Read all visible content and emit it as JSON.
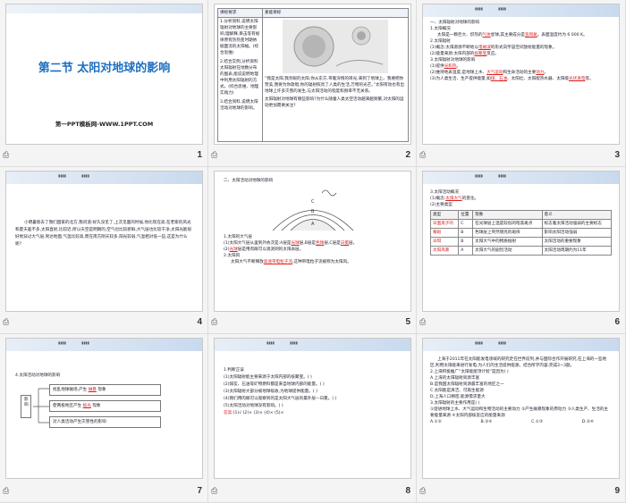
{
  "footer_icon": "⎙",
  "slides": [
    {
      "num": "1",
      "title": "第二节  太阳对地球的影响",
      "subtitle": "第一PPT模板网-WWW.1PPT.COM"
    },
    {
      "num": "2",
      "head_left": "课标要求",
      "head_right": "素能目标",
      "left_lines": [
        "1.分析资料,说明太阳辐射对地球的主要影响,理解释,目击等有规律原有热热变时期依据面流的太阳幅。(综合思维)",
        "2.结合实例,分析资料太阳辐射在地数分布的图表,能说说明地理中利用太阳辐射的方式。(综合思维、地理实践力)",
        "3.结合资料,说明太阳活动对地球的影响。"
      ],
      "right_text": "“我是太阳,我亲眼的太阳,你从东方,带着深情的目光,来到了地球上。我要把你赞美,我要为你歌唱,你的辐射照亮了人类的生活,万物的光芒。”太阳有动也有出地球上许多灾害的发生,与太阳活动的程度和频率不无关系。",
      "right_q": "太阳辐射对地球有哪些影响?为什么随着人类太空活动越来越频繁,对太阳的运动更加需要关注?"
    },
    {
      "num": "3",
      "heading": "一、太阳辐射对地球的影响",
      "s1": "1.太阳概况",
      "p1a": "太阳是一颗巨大、炽热的",
      "p1b": "气体",
      "p1c": "星球,其主要成分是",
      "p1d": "氢和氦",
      "p1e": "。表面温度约为 6 000 K。",
      "s2": "2.太阳辐射",
      "p2a": "(1)概念:太阳源源不断地以",
      "p2b": "电磁波",
      "p2c": "的形式向宇宙空间放射能量的现象。",
      "p3a": "(2)能量来源:太阳内部的",
      "p3b": "核聚变",
      "p3c": "反应。",
      "s3": "3.太阳辐射对地球的影响",
      "p4a": "(1)提供",
      "p4b": "光和热",
      "p4c": "。",
      "p5a": "(2)维持地表温度,是地球上水、",
      "p5b": "大气运动",
      "p5c": "和生命活动的主要",
      "p5d": "动力",
      "p5e": "。",
      "p6a": "(3)为人类生活、生产提供能量,如",
      "p6b": "煤、石油",
      "p6c": "、太阳灶、太阳能热水器、太阳能",
      "p6d": "光伏发电",
      "p6e": "等。"
    },
    {
      "num": "4",
      "paragraph": "小明暑假去了我们国家的北方,我问道:好久没见了,上次见面的时候,你比现在高,在老家的风光和夏天差不多,太阳直射,比较近,所以天空是明朗的,空气也比较新鲜,大气层也比较干净,太阳光能很好地穿过大气层,到达地面,气温比较高,而在南方阴天较多,阳光较弱,气温相对低一些,这是为什么呢?"
    },
    {
      "num": "5",
      "heading": "二、太阳活动对地球的影响",
      "s1": "1.太阳的大气层",
      "p1a": "(1)太阳大气层从里到外依次是:A层是",
      "p1b": "光球",
      "p1c": "层,B层是",
      "p1d": "色球",
      "p1e": "层,C层是",
      "p1f": "日冕",
      "p1g": "层。",
      "p2a": "(2)",
      "p2b": "光球",
      "p2c": "层是用肉眼可以观测到的太阳表层。",
      "s2": "2.太阳风",
      "p3a": "太阳大气不断释放",
      "p3b": "高速带电粒子流",
      "p3c": ",这种带电粒子流被称为太阳风。",
      "lbl_a": "A",
      "lbl_b": "B",
      "lbl_c": "C"
    },
    {
      "num": "6",
      "s1": "3.太阳活动概况",
      "p1a": "(1)概念:",
      "p1b": "太阳大气",
      "p1c": "的变化。",
      "p2": "(2)主要类型",
      "cols": [
        "类型",
        "位置",
        "现象",
        "意义"
      ],
      "rows": [
        [
          "日面黑子的",
          "C",
          "在光球层上温度较低的暗黑斑点",
          "标志着太阳活动强弱的主要标志"
        ],
        [
          "耀斑",
          "B",
          "色球层上突然增亮的斑块",
          "影响太阳活动强弱"
        ],
        [
          "日珥",
          "B",
          "太阳大气中的物质抛射",
          "太阳活动的重要现象"
        ],
        [
          "太阳风暴",
          "A",
          "太阳大气的剧烈活动",
          "太阳活动周期约为11年"
        ]
      ]
    },
    {
      "num": "7",
      "heading": "4.太阳活动对地球的影响",
      "left_box": "影响",
      "items": [
        {
          "a": "扰乱地球磁场,产生",
          "b": "磁暴",
          "c": "现象"
        },
        {
          "a": "使两极地区产生",
          "b": "极光",
          "c": "现象"
        },
        {
          "a": "对人类活动产生灾害性的影响",
          "b": "",
          "c": ""
        }
      ]
    },
    {
      "num": "8",
      "heading": "1.判断正误",
      "lines": [
        "(1)太阳辐射能主要来源于太阳内部的核聚变。(   )",
        "(2)煤炭、石油等矿物燃料都是来自地球内部的能量。(   )",
        "(3)太阳辐射大部分被地球吸收,为地球提供能量。(   )",
        "(4)我们用肉眼可以观察到的是太阳大气层的最外层—日冕。(   )",
        "(5)太阳活动对地球没有影响。(   )"
      ],
      "answer_label": "答案:",
      "answer": "(1)√  (2)×  (3)×  (4)×  (5)×"
    },
    {
      "num": "9",
      "intro": "上海于2011年在太阳能发电领域的研究走在世界前列,并与国际合作开展研究,在上海的一些地区,利用太阳能来进行发电,为人们的生活提供能源。结合所学内容,完成2~3题。",
      "q2": "2.上海积极推广“太阳能屋顶计划”是因为(    )",
      "q2opts": [
        "A.上海的太阳辐射资源丰富",
        "B.是我国太阳辐射资源最丰富的地区之一",
        "C.太阳能是清洁、可再生能源",
        "D.上海人口稠密,能源需求量大"
      ],
      "q3": "3.太阳辐射的主要作用是(    )",
      "q3text": "①促进地球上水、大气运动和生物活动的主要动力 ②产生磁暴现象的原动力 ③人类生产、生活的主要能量来源 ④太阳内部核反应的能量来源",
      "q3opts": [
        "A.①②",
        "B.②④",
        "C.①③",
        "D.②④"
      ]
    }
  ]
}
